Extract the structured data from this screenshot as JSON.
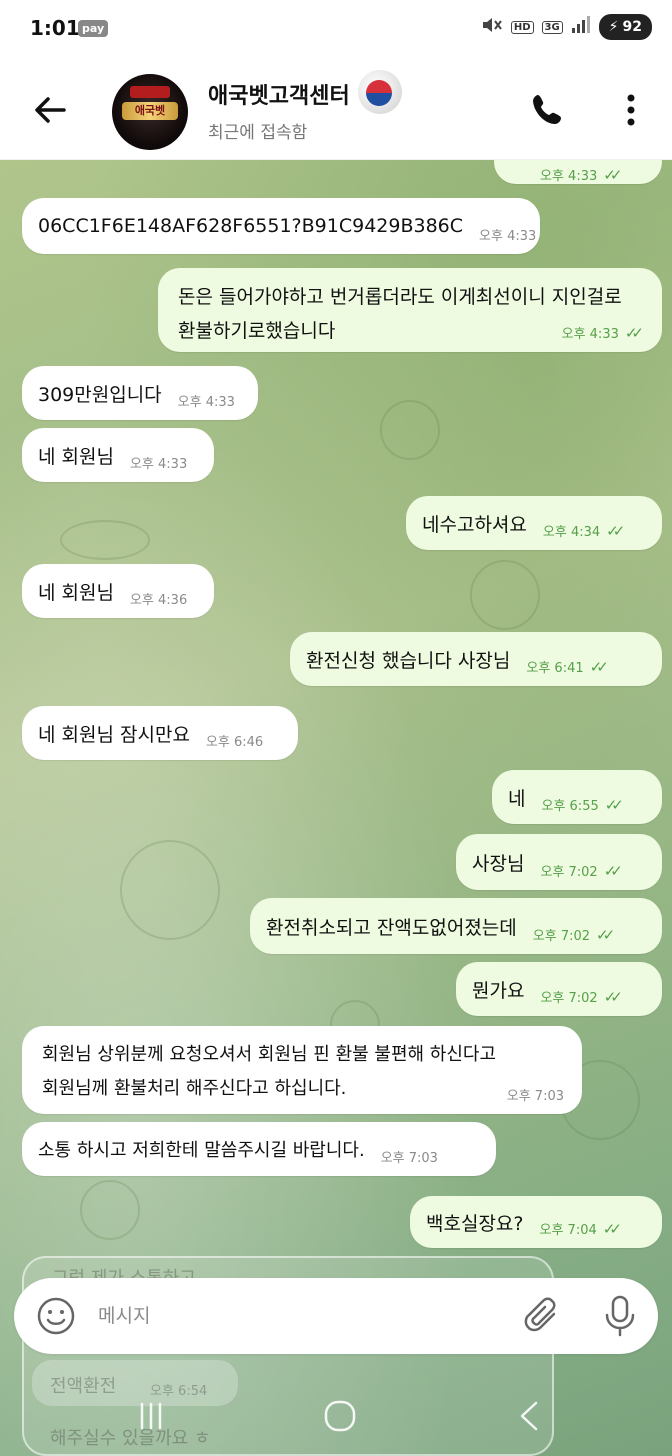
{
  "status_bar": {
    "time": "1:01",
    "pay_badge": "pay",
    "hd_badge": "HD",
    "network": "3G",
    "battery": "92"
  },
  "header": {
    "chat_name": "애국벳고객센터",
    "status": "최근에 접속함",
    "avatar_text": "애국벳"
  },
  "messages": [
    {
      "dir": "in",
      "text": "06CC1F6E148AF628F6551?B91C9429B386C",
      "time": "오후 4:33"
    },
    {
      "dir": "out",
      "lines": [
        "돈은 들어가야하고 번거롭더라도 이게최선이니 지인걸로",
        "환불하기로했습니다"
      ],
      "time": "오후 4:33"
    },
    {
      "dir": "in",
      "text": "309만원입니다",
      "time": "오후 4:33"
    },
    {
      "dir": "in",
      "text": "네 회원님",
      "time": "오후 4:33"
    },
    {
      "dir": "out",
      "text": "네수고하셔요",
      "time": "오후 4:34"
    },
    {
      "dir": "in",
      "text": "네 회원님",
      "time": "오후 4:36"
    },
    {
      "dir": "out",
      "text": "환전신청 했습니다 사장님",
      "time": "오후 6:41"
    },
    {
      "dir": "in",
      "text": "네 회원님 잠시만요",
      "time": "오후 6:46"
    },
    {
      "dir": "out",
      "text": "네",
      "time": "오후 6:55"
    },
    {
      "dir": "out",
      "text": "사장님",
      "time": "오후 7:02"
    },
    {
      "dir": "out",
      "text": "환전취소되고 잔액도없어졌는데",
      "time": "오후 7:02"
    },
    {
      "dir": "out",
      "text": "뭔가요",
      "time": "오후 7:02"
    },
    {
      "dir": "in",
      "lines": [
        "회원님 상위분께 요청오셔서 회원님 핀 환불 불편해 하신다고",
        "회원님께 환불처리 해주신다고 하십니다."
      ],
      "time": "오후 7:03"
    },
    {
      "dir": "in",
      "text": "소통 하시고 저희한테 말씀주시길 바랍니다.",
      "time": "오후 7:03"
    },
    {
      "dir": "out",
      "text": "백호실장요?",
      "time": "오후 7:04"
    }
  ],
  "top_partial_time": "오후 4:33",
  "reply_preview": {
    "line1": "그럼 제가 소통하고",
    "line2": "전액환전",
    "line2_time": "오후 6:54",
    "line3": "해주실수 있을까요 ㅎ"
  },
  "input": {
    "placeholder": "메시지"
  },
  "colors": {
    "incoming_bubble": "#ffffff",
    "outgoing_bubble": "#eefbe0",
    "check_green": "#56a04a"
  },
  "icons": [
    "arrow-left-icon",
    "phone-icon",
    "more-vert-icon",
    "emoji-icon",
    "paperclip-icon",
    "mic-icon",
    "recent-apps-icon",
    "home-icon",
    "nav-back-icon"
  ]
}
